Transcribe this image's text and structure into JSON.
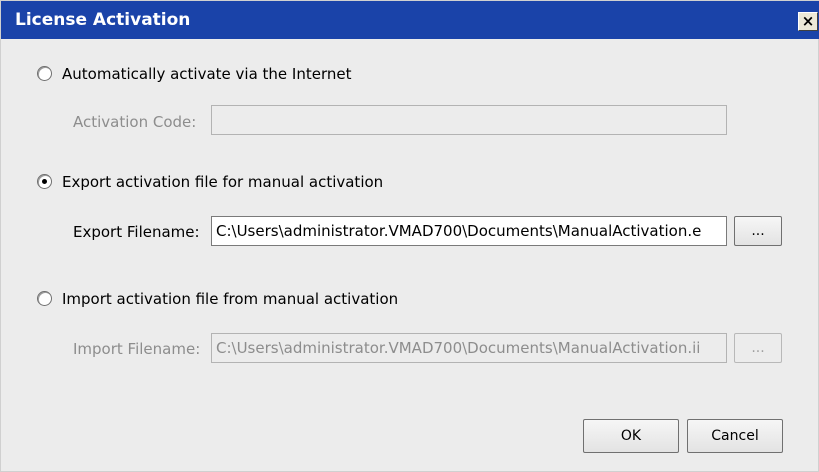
{
  "window": {
    "title": "License Activation",
    "close_label": "×"
  },
  "options": {
    "auto": {
      "label": "Automatically activate via the Internet",
      "selected": false,
      "code_label": "Activation Code:",
      "code_value": ""
    },
    "export": {
      "label": "Export activation file for manual activation",
      "selected": true,
      "filename_label": "Export Filename:",
      "filename_value": "C:\\Users\\administrator.VMAD700\\Documents\\ManualActivation.e",
      "browse_label": "..."
    },
    "import": {
      "label": "Import activation file from manual activation",
      "selected": false,
      "filename_label": "Import Filename:",
      "filename_value": "C:\\Users\\administrator.VMAD700\\Documents\\ManualActivation.ii",
      "browse_label": "..."
    }
  },
  "buttons": {
    "ok_label": "OK",
    "cancel_label": "Cancel"
  }
}
